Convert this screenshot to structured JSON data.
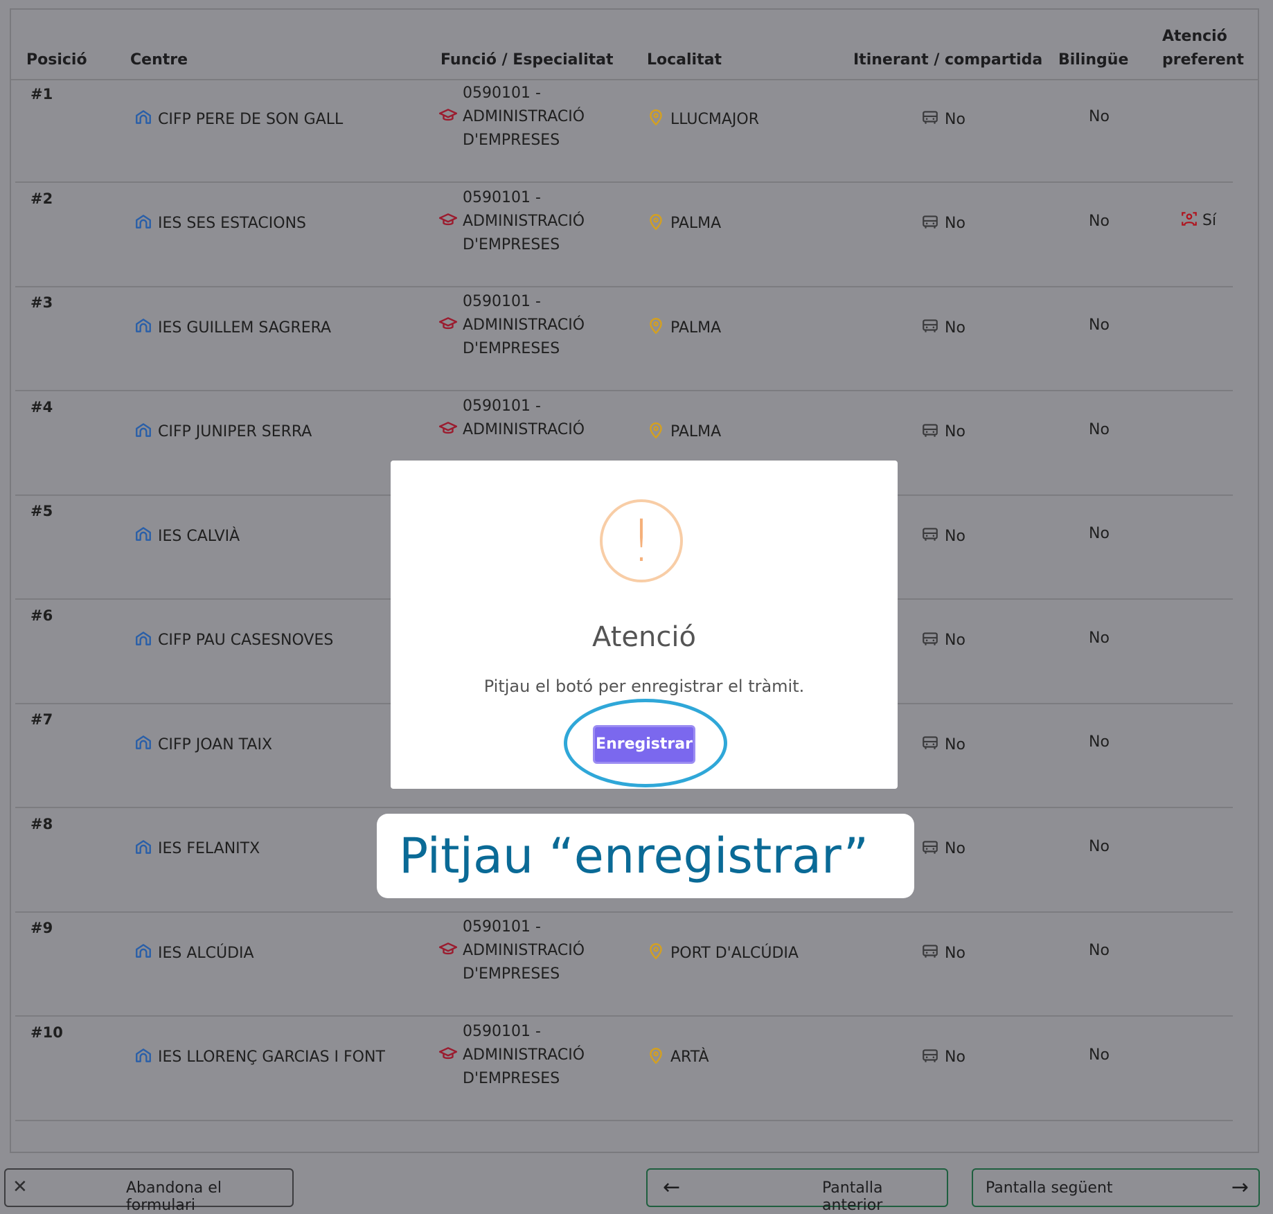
{
  "table": {
    "headers": {
      "posicio": "Posició",
      "centre": "Centre",
      "funcio": "Funció / Especialitat",
      "localitat": "Localitat",
      "itinerant": "Itinerant / compartida",
      "bilingue": "Bilingüe",
      "atencio_line1": "Atenció",
      "atencio_line2": "preferent"
    },
    "rows": [
      {
        "pos": "#1",
        "centre": "CIFP PERE DE SON GALL",
        "code": "0590101 -",
        "spec1": "ADMINISTRACIÓ",
        "spec2": "D'EMPRESES",
        "loc": "LLUCMAJOR",
        "itin": "No",
        "bil": "No",
        "pref": ""
      },
      {
        "pos": "#2",
        "centre": "IES SES ESTACIONS",
        "code": "0590101 -",
        "spec1": "ADMINISTRACIÓ",
        "spec2": "D'EMPRESES",
        "loc": "PALMA",
        "itin": "No",
        "bil": "No",
        "pref": "Sí"
      },
      {
        "pos": "#3",
        "centre": "IES GUILLEM SAGRERA",
        "code": "0590101 -",
        "spec1": "ADMINISTRACIÓ",
        "spec2": "D'EMPRESES",
        "loc": "PALMA",
        "itin": "No",
        "bil": "No",
        "pref": ""
      },
      {
        "pos": "#4",
        "centre": "CIFP JUNIPER SERRA",
        "code": "0590101 -",
        "spec1": "ADMINISTRACIÓ",
        "spec2": "",
        "loc": "PALMA",
        "itin": "No",
        "bil": "No",
        "pref": ""
      },
      {
        "pos": "#5",
        "centre": "IES CALVIÀ",
        "code": "",
        "spec1": "",
        "spec2": "",
        "loc": "",
        "itin": "No",
        "bil": "No",
        "pref": ""
      },
      {
        "pos": "#6",
        "centre": "CIFP PAU CASESNOVES",
        "code": "",
        "spec1": "",
        "spec2": "",
        "loc": "",
        "itin": "No",
        "bil": "No",
        "pref": ""
      },
      {
        "pos": "#7",
        "centre": "CIFP JOAN TAIX",
        "code": "",
        "spec1": "",
        "spec2": "",
        "loc": "",
        "itin": "No",
        "bil": "No",
        "pref": ""
      },
      {
        "pos": "#8",
        "centre": "IES FELANITX",
        "code": "",
        "spec1": "",
        "spec2": "",
        "loc": "",
        "itin": "No",
        "bil": "No",
        "pref": ""
      },
      {
        "pos": "#9",
        "centre": "IES ALCÚDIA",
        "code": "0590101 -",
        "spec1": "ADMINISTRACIÓ",
        "spec2": "D'EMPRESES",
        "loc": "PORT D'ALCÚDIA",
        "itin": "No",
        "bil": "No",
        "pref": ""
      },
      {
        "pos": "#10",
        "centre": "IES LLORENÇ GARCIAS I FONT",
        "code": "0590101 -",
        "spec1": "ADMINISTRACIÓ",
        "spec2": "D'EMPRESES",
        "loc": "ARTÀ",
        "itin": "No",
        "bil": "No",
        "pref": ""
      }
    ]
  },
  "footer": {
    "abandon_label": "Abandona el formulari",
    "prev_label": "Pantalla anterior",
    "next_label": "Pantalla següent"
  },
  "modal": {
    "icon": "!",
    "title": "Atenció",
    "text": "Pitjau el botó per enregistrar el tràmit.",
    "button_label": "Enregistrar"
  },
  "callout": {
    "text": "Pitjau “enregistrar”"
  },
  "colors": {
    "school_icon": "#2a5fa8",
    "specialty_icon": "#9b1b2e",
    "location_icon": "#d4a020",
    "button": "#7b68ee",
    "callout_text": "#0a6a96",
    "ring": "#2fa7d8"
  }
}
